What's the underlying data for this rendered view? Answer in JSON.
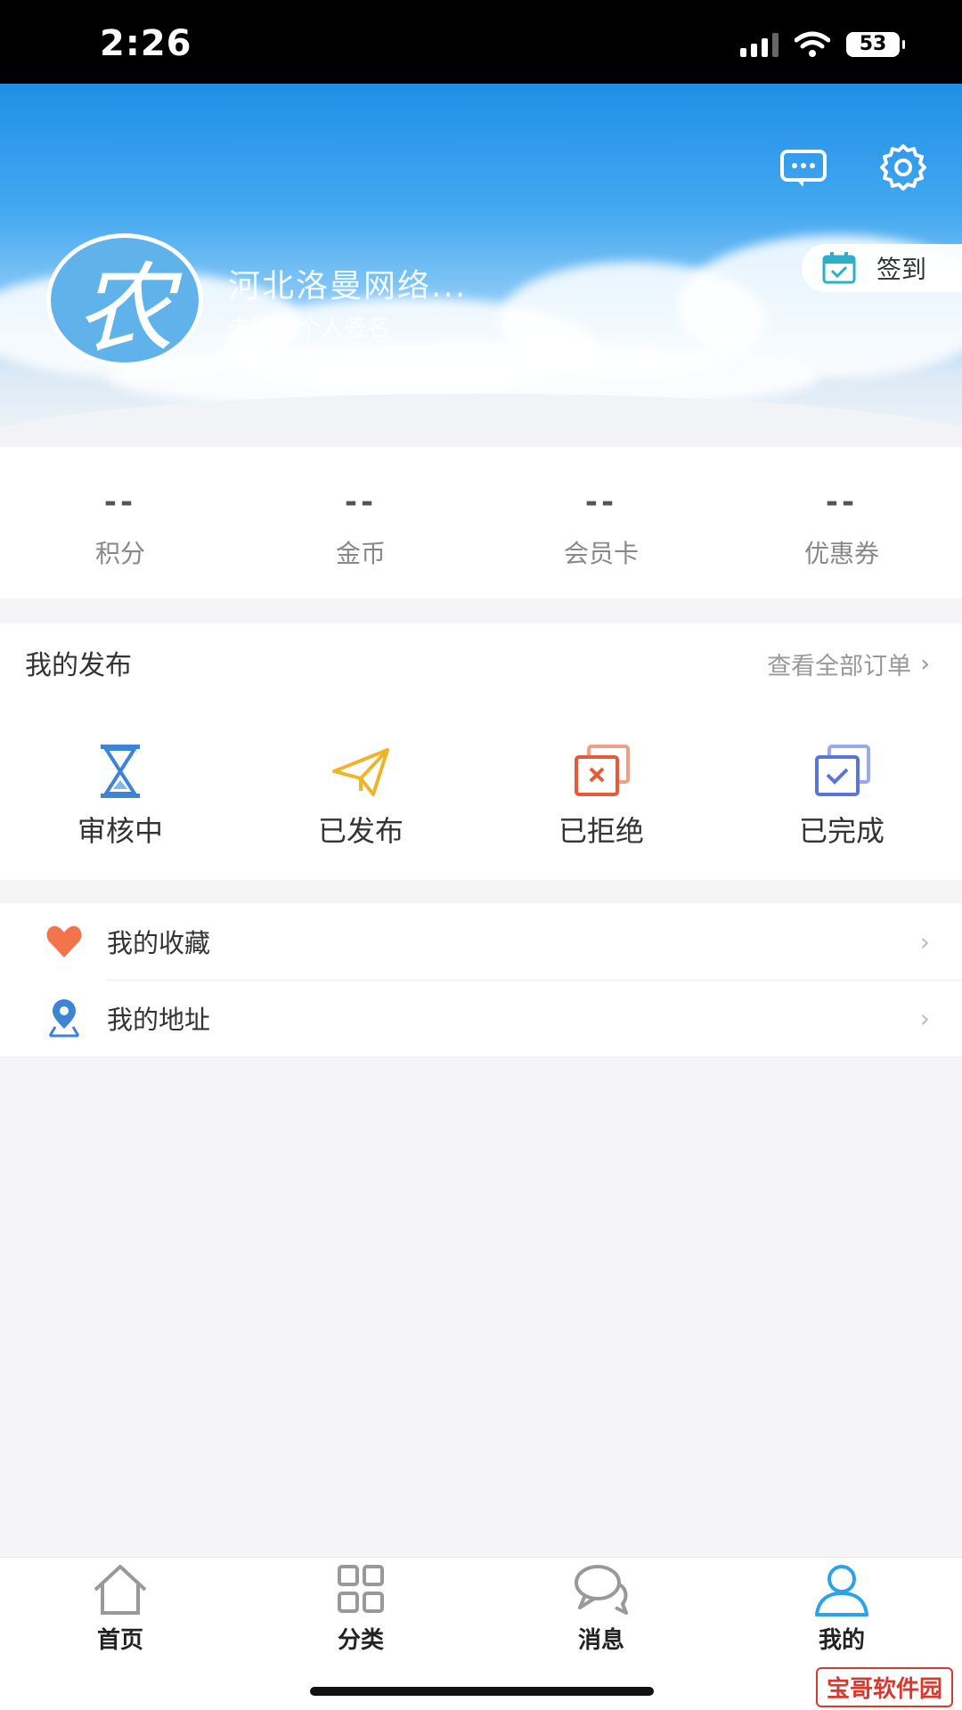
{
  "status_bar": {
    "time": "2:26",
    "battery": "53"
  },
  "header": {
    "avatar_text": "农",
    "user_name": "河北洛曼网络...",
    "signature": "未填写个人签名",
    "checkin_label": "签到",
    "icons": {
      "message": "chat-bubble-icon",
      "settings": "gear-icon",
      "checkin": "calendar-check-icon"
    }
  },
  "stats": [
    {
      "value": "--",
      "label": "积分"
    },
    {
      "value": "--",
      "label": "金币"
    },
    {
      "value": "--",
      "label": "会员卡"
    },
    {
      "value": "--",
      "label": "优惠券"
    }
  ],
  "publish": {
    "title": "我的发布",
    "view_all": "查看全部订单",
    "items": [
      {
        "label": "审核中",
        "icon": "hourglass-icon"
      },
      {
        "label": "已发布",
        "icon": "paper-plane-icon"
      },
      {
        "label": "已拒绝",
        "icon": "rejected-icon"
      },
      {
        "label": "已完成",
        "icon": "completed-icon"
      }
    ]
  },
  "list": [
    {
      "label": "我的收藏",
      "icon": "heart-icon"
    },
    {
      "label": "我的地址",
      "icon": "location-pin-icon"
    }
  ],
  "tabs": [
    {
      "label": "首页",
      "icon": "home-icon"
    },
    {
      "label": "分类",
      "icon": "grid-icon"
    },
    {
      "label": "消息",
      "icon": "chat-icon"
    },
    {
      "label": "我的",
      "icon": "user-icon",
      "active": true
    }
  ],
  "colors": {
    "accent": "#2aa3e8",
    "reject": "#e8593a",
    "publish": "#f0b429",
    "review": "#3d84d6",
    "complete": "#5a74d8"
  },
  "watermark": "宝哥软件园"
}
